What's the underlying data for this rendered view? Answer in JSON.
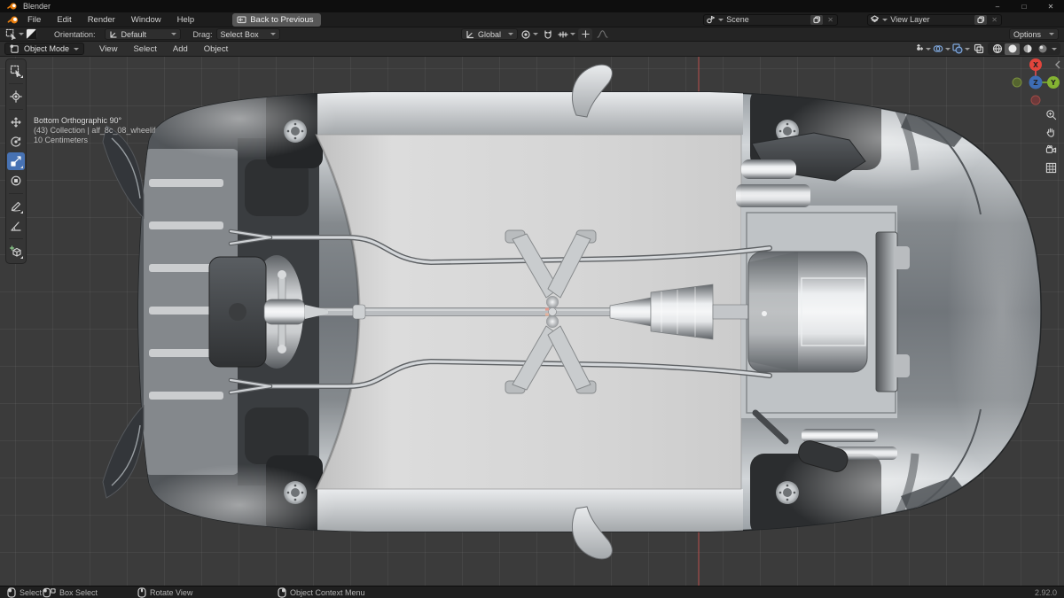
{
  "colors": {
    "accent_blue": "#4772b3",
    "axis_x_red": "#e2453c",
    "axis_y_green": "#84b332",
    "axis_z_blue": "#3d6cb4",
    "viewport_bg": "#3b3b3b"
  },
  "window": {
    "title": "Blender",
    "minimize_glyph": "–",
    "maximize_glyph": "□",
    "close_glyph": "✕"
  },
  "menubar": {
    "items": [
      "File",
      "Edit",
      "Render",
      "Window",
      "Help"
    ],
    "back_button_label": "Back to Previous",
    "scene_selector_value": "Scene",
    "view_layer_selector_value": "View Layer"
  },
  "tool_settings": {
    "orientation_label": "Orientation:",
    "orientation_value": "Default",
    "drag_label": "Drag:",
    "drag_value": "Select Box",
    "transform_orientation_value": "Global",
    "options_button_label": "Options"
  },
  "viewport_header": {
    "mode_selector_value": "Object Mode",
    "menus": [
      "View",
      "Select",
      "Add",
      "Object"
    ]
  },
  "viewport_overlay": {
    "view_name": "Bottom Orthographic 90°",
    "collection_info": "(43) Collection | alf_8c_08_wheelif",
    "scale_info": "10 Centimeters"
  },
  "axis_gizmo": {
    "x_label": "X",
    "y_label": "Y",
    "z_label": "Z"
  },
  "left_toolbar": {
    "tools": [
      "select-box",
      "cursor",
      "move",
      "rotate",
      "scale",
      "transform",
      "annotate",
      "measure",
      "add-cube"
    ],
    "active_tool": "scale"
  },
  "shading": {
    "modes": [
      "wireframe",
      "solid",
      "material-preview",
      "rendered"
    ],
    "active_mode": "solid"
  },
  "statusbar": {
    "select_label": "Select",
    "box_select_label": "Box Select",
    "rotate_view_label": "Rotate View",
    "context_menu_label": "Object Context Menu",
    "version": "2.92.0"
  }
}
